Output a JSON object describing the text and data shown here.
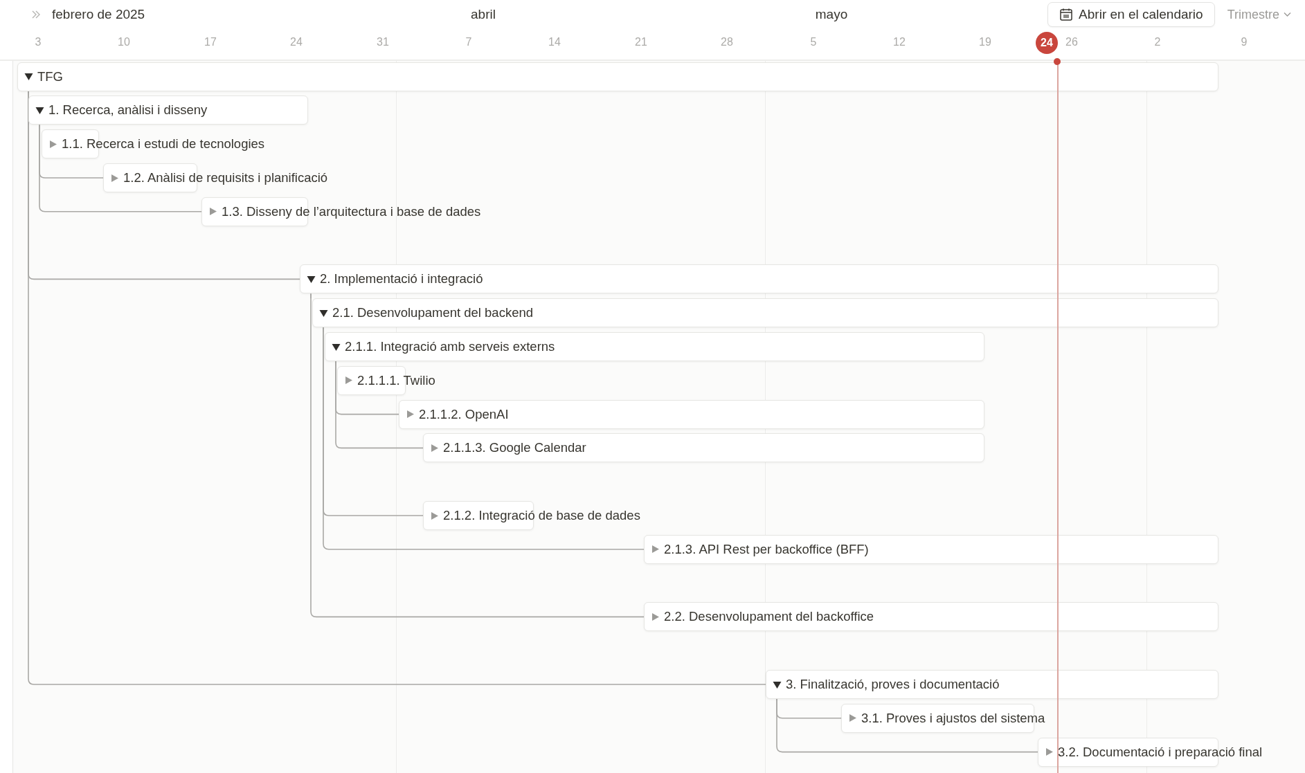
{
  "header": {
    "months": [
      "febrero de 2025",
      "abril",
      "mayo"
    ],
    "weeks": [
      {
        "label": "3",
        "today": false
      },
      {
        "label": "10",
        "today": false
      },
      {
        "label": "17",
        "today": false
      },
      {
        "label": "24",
        "today": false
      },
      {
        "label": "31",
        "today": false
      },
      {
        "label": "7",
        "today": false
      },
      {
        "label": "14",
        "today": false
      },
      {
        "label": "21",
        "today": false
      },
      {
        "label": "28",
        "today": false
      },
      {
        "label": "5",
        "today": false
      },
      {
        "label": "12",
        "today": false
      },
      {
        "label": "19",
        "today": false
      },
      {
        "label": "24",
        "today": true
      },
      {
        "label": "26",
        "today": false
      },
      {
        "label": "2",
        "today": false
      },
      {
        "label": "9",
        "today": false
      }
    ],
    "calendar_button": "Abrir en el calendario",
    "range_select": "Trimestre"
  },
  "tasks": [
    {
      "title": "TFG",
      "expanded": true,
      "children": [
        {
          "title": "1. Recerca, anàlisi i disseny",
          "expanded": true,
          "children": [
            {
              "title": "1.1. Recerca i estudi de tecnologies",
              "expanded": false
            },
            {
              "title": "1.2. Anàlisi de requisits i planificació",
              "expanded": false
            },
            {
              "title": "1.3. Disseny de l’arquitectura i base de dades",
              "expanded": false
            }
          ]
        },
        {
          "title": "2. Implementació i integració",
          "expanded": true,
          "children": [
            {
              "title": "2.1. Desenvolupament del backend",
              "expanded": true,
              "children": [
                {
                  "title": "2.1.1. Integració amb serveis externs",
                  "expanded": true,
                  "children": [
                    {
                      "title": "2.1.1.1. Twilio",
                      "expanded": false
                    },
                    {
                      "title": "2.1.1.2. OpenAI",
                      "expanded": false
                    },
                    {
                      "title": "2.1.1.3. Google Calendar",
                      "expanded": false
                    }
                  ]
                },
                {
                  "title": "2.1.2. Integració de base de dades",
                  "expanded": false
                },
                {
                  "title": "2.1.3. API Rest per backoffice (BFF)",
                  "expanded": false
                }
              ]
            },
            {
              "title": "2.2. Desenvolupament del backoffice",
              "expanded": false
            }
          ]
        },
        {
          "title": "3. Finalització, proves i documentació",
          "expanded": true,
          "children": [
            {
              "title": "3.1. Proves i ajustos del sistema",
              "expanded": false
            },
            {
              "title": "3.2. Documentació i preparació final",
              "expanded": false
            }
          ]
        }
      ]
    }
  ]
}
